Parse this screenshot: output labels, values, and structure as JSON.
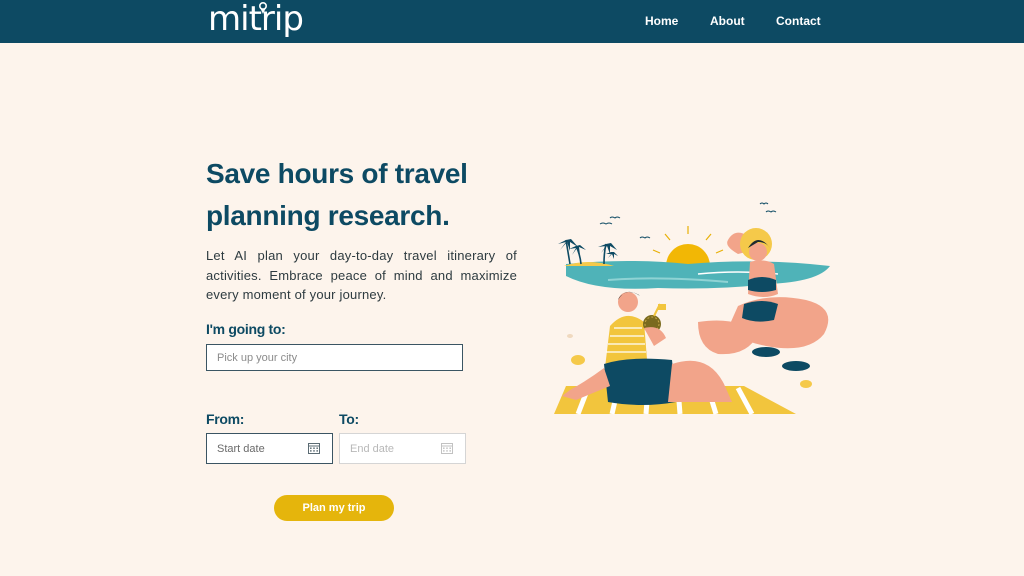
{
  "nav": {
    "logo_text": "mitrip",
    "links": [
      {
        "label": "Home"
      },
      {
        "label": "About"
      },
      {
        "label": "Contact"
      }
    ]
  },
  "hero": {
    "headline": "Save hours of travel planning research.",
    "description": "Let AI plan your day-to-day travel itinerary of activities. Embrace peace of mind and maximize every moment of your journey."
  },
  "form": {
    "destination": {
      "label": "I'm going to:",
      "placeholder": "Pick up your city",
      "value": ""
    },
    "from": {
      "label": "From:",
      "placeholder": "Start date",
      "icon": "calendar-icon"
    },
    "to": {
      "label": "To:",
      "placeholder": "End date",
      "icon": "calendar-icon"
    },
    "submit_label": "Plan my trip"
  },
  "colors": {
    "navbar": "#0d4a63",
    "background": "#fdf4ec",
    "accent": "#e5b50c",
    "heading": "#0d4a63"
  },
  "illustration": {
    "icon": "beach-illustration"
  }
}
